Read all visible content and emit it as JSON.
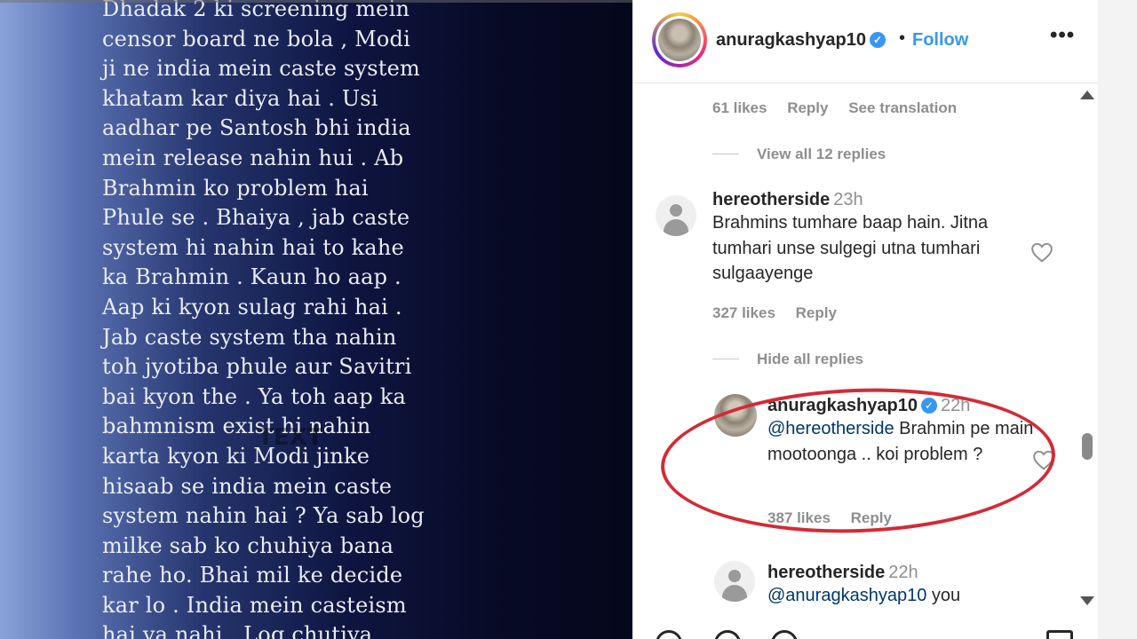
{
  "story": {
    "text": "Dhadak 2 ki screening mein\ncensor board ne bola , Modi\nji ne india mein caste system\nkhatam kar diya hai . Usi\naadhar pe Santosh bhi india\nmein release nahin hui . Ab\nBrahmin ko problem hai\nPhule se . Bhaiya , jab caste\nsystem hi nahin hai to kahe\nka Brahmin . Kaun ho aap .\nAap ki kyon sulag rahi hai .\nJab caste system tha nahin\ntoh jyotiba phule aur Savitri\nbai kyon the . Ya toh aap ka\nbahmnism exist hi nahin\nkarta kyon ki Modi jinke\nhisaab se india mein caste\nsystem nahin hai ? Ya sab log\nmilke sab ko chuhiya bana\nrahe ho. Bhai mil ke decide\nkar lo . India mein casteism\nhai ya nahi . Log chutiya",
    "watermark": "TEXT"
  },
  "post_header": {
    "username": "anuragkashyap10",
    "verified_icon": "verified-badge-icon",
    "separator": "•",
    "follow_label": "Follow",
    "more_label": "•••"
  },
  "prev_comment_meta": {
    "likes": "61 likes",
    "reply": "Reply",
    "translation": "See translation"
  },
  "view_replies": "View all 12 replies",
  "comment1": {
    "username": "hereotherside",
    "time": "23h",
    "text": "Brahmins tumhare baap hain. Jitna tumhari unse sulgegi utna tumhari sulgaayenge",
    "likes": "327 likes",
    "reply": "Reply"
  },
  "hide_replies": "Hide all replies",
  "comment2": {
    "username": "anuragkashyap10",
    "time": "22h",
    "mention": "@hereotherside",
    "text": " Brahmin pe main mootoonga .. koi problem ?",
    "likes": "387 likes",
    "reply": "Reply"
  },
  "comment3": {
    "username": "hereotherside",
    "time": "22h",
    "mention": "@anuragkashyap10",
    "text": " you"
  },
  "colors": {
    "accent": "#3897f0",
    "highlight_ring": "#d42a36",
    "muted": "#8e8e8e"
  }
}
